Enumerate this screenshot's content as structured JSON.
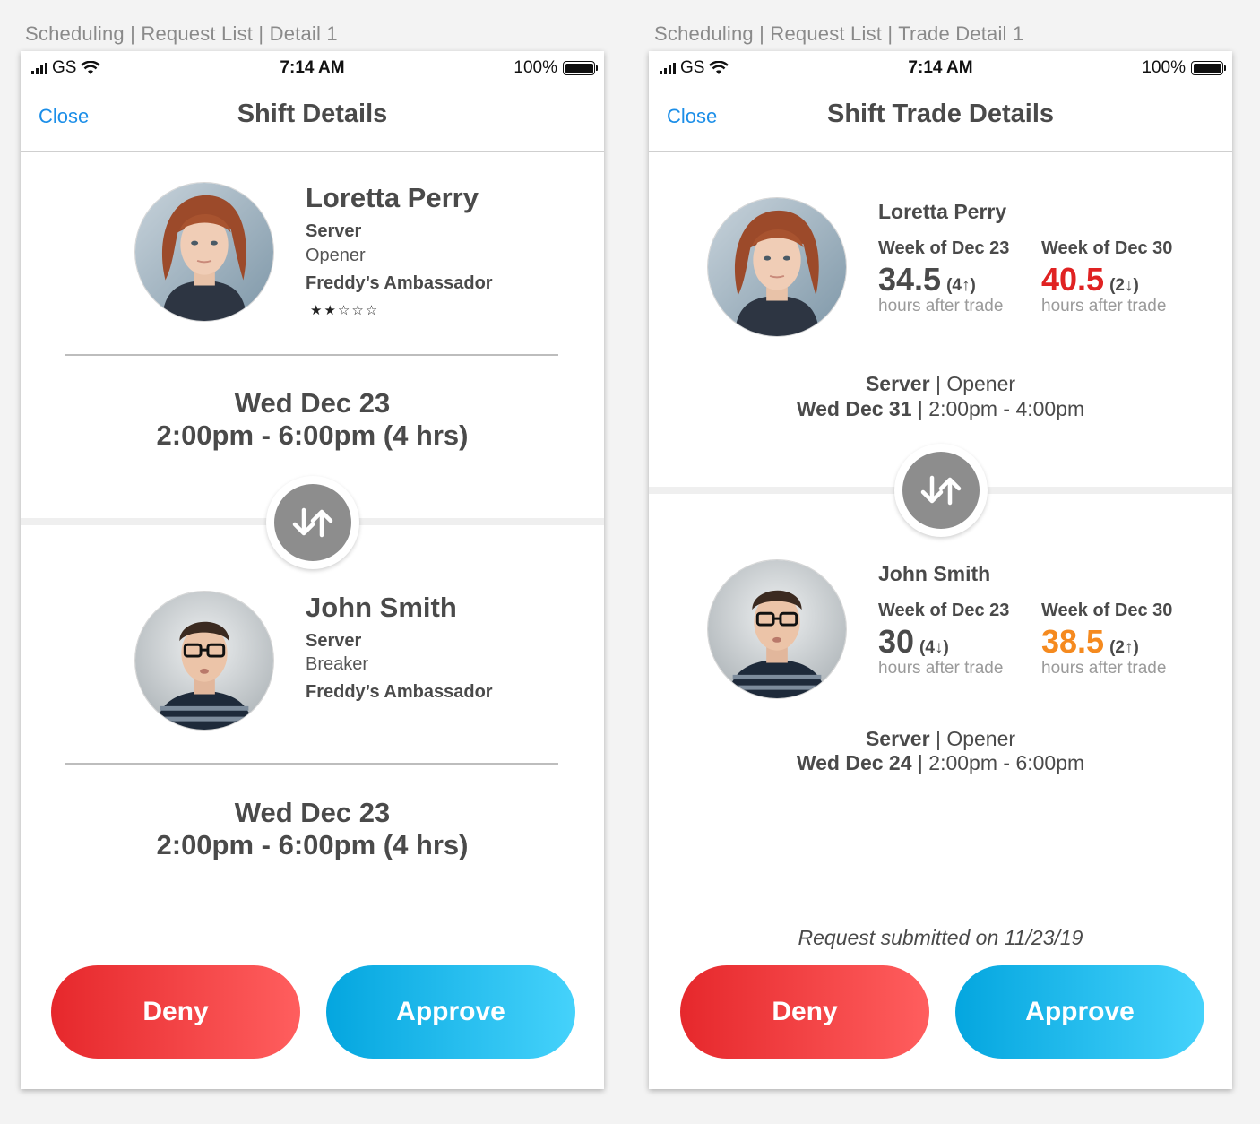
{
  "screen1": {
    "label": "Scheduling | Request List | Detail 1",
    "status": {
      "carrier": "GS",
      "time": "7:14 AM",
      "battery": "100%"
    },
    "nav": {
      "close": "Close",
      "title": "Shift Details"
    },
    "employee1": {
      "name": "Loretta Perry",
      "role": "Server",
      "shift": "Opener",
      "badge": "Freddy’s Ambassador",
      "stars": "★★☆☆☆",
      "rating": 2
    },
    "shift1": {
      "date": "Wed Dec 23",
      "time": "2:00pm - 6:00pm (4 hrs)"
    },
    "employee2": {
      "name": "John Smith",
      "role": "Server",
      "shift": "Breaker",
      "badge": "Freddy’s Ambassador"
    },
    "shift2": {
      "date": "Wed Dec 23",
      "time": "2:00pm - 6:00pm (4 hrs)"
    },
    "buttons": {
      "deny": "Deny",
      "approve": "Approve"
    }
  },
  "screen2": {
    "label": "Scheduling | Request List | Trade Detail 1",
    "status": {
      "carrier": "GS",
      "time": "7:14 AM",
      "battery": "100%"
    },
    "nav": {
      "close": "Close",
      "title": "Shift Trade Details"
    },
    "employee1": {
      "name": "Loretta Perry",
      "week1": {
        "label": "Week of Dec 23",
        "value": "34.5",
        "delta": "(4↑)",
        "sub": "hours after trade"
      },
      "week2": {
        "label": "Week of Dec 30",
        "value": "40.5",
        "delta": "(2↓)",
        "sub": "hours after trade",
        "color": "#e02222"
      },
      "shift": {
        "role": "Server",
        "sep1": "|",
        "type": "Opener",
        "date": "Wed Dec 31",
        "sep2": "|",
        "time": "2:00pm - 4:00pm"
      }
    },
    "employee2": {
      "name": "John Smith",
      "week1": {
        "label": "Week of Dec 23",
        "value": "30",
        "delta": "(4↓)",
        "sub": "hours after trade"
      },
      "week2": {
        "label": "Week of Dec 30",
        "value": "38.5",
        "delta": "(2↑)",
        "sub": "hours after trade",
        "color": "#f58a1f"
      },
      "shift": {
        "role": "Server",
        "sep1": "|",
        "type": "Opener",
        "date": "Wed Dec 24",
        "sep2": "|",
        "time": "2:00pm - 6:00pm"
      }
    },
    "submitted": "Request submitted on 11/23/19",
    "buttons": {
      "deny": "Deny",
      "approve": "Approve"
    }
  },
  "icons": {
    "signal": "cellular-signal-icon",
    "wifi": "wifi-icon",
    "battery": "battery-icon",
    "swap": "swap-arrows-icon"
  }
}
